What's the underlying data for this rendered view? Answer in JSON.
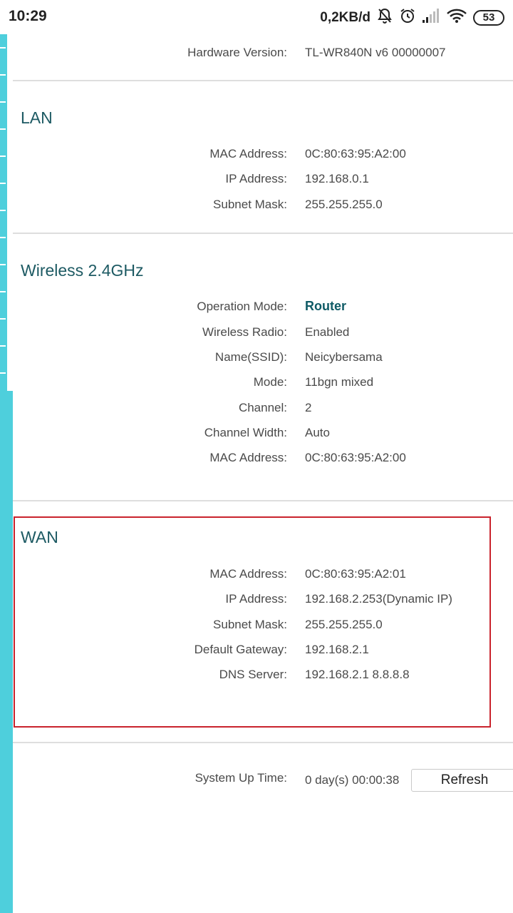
{
  "status_bar": {
    "time": "10:29",
    "speed": "0,2KB/d",
    "battery": "53",
    "icons": [
      "muted-notification-icon",
      "alarm-icon",
      "signal-icon",
      "wifi-icon",
      "battery-icon"
    ]
  },
  "hardware": {
    "label": "Hardware Version:",
    "value": "TL-WR840N v6 00000007"
  },
  "lan": {
    "title": "LAN",
    "rows": [
      {
        "label": "MAC Address:",
        "value": "0C:80:63:95:A2:00"
      },
      {
        "label": "IP Address:",
        "value": "192.168.0.1"
      },
      {
        "label": "Subnet Mask:",
        "value": "255.255.255.0"
      }
    ]
  },
  "wireless": {
    "title": "Wireless 2.4GHz",
    "rows": [
      {
        "label": "Operation Mode:",
        "value": "Router"
      },
      {
        "label": "Wireless Radio:",
        "value": "Enabled"
      },
      {
        "label": "Name(SSID):",
        "value": "Neicybersama"
      },
      {
        "label": "Mode:",
        "value": "11bgn mixed"
      },
      {
        "label": "Channel:",
        "value": "2"
      },
      {
        "label": "Channel Width:",
        "value": "Auto"
      },
      {
        "label": "MAC Address:",
        "value": "0C:80:63:95:A2:00"
      }
    ]
  },
  "wan": {
    "title": "WAN",
    "rows": [
      {
        "label": "MAC Address:",
        "value": "0C:80:63:95:A2:01"
      },
      {
        "label": "IP Address:",
        "value": "192.168.2.253(Dynamic IP)"
      },
      {
        "label": "Subnet Mask:",
        "value": "255.255.255.0"
      },
      {
        "label": "Default Gateway:",
        "value": "192.168.2.1"
      },
      {
        "label": "DNS Server:",
        "value": "192.168.2.1 8.8.8.8"
      }
    ]
  },
  "uptime": {
    "label": "System Up Time:",
    "value": "0 day(s) 00:00:38",
    "refresh_label": "Refresh"
  },
  "colors": {
    "accent": "#4ecfdc",
    "title": "#1d5a63",
    "highlight_box": "#c9232c"
  }
}
